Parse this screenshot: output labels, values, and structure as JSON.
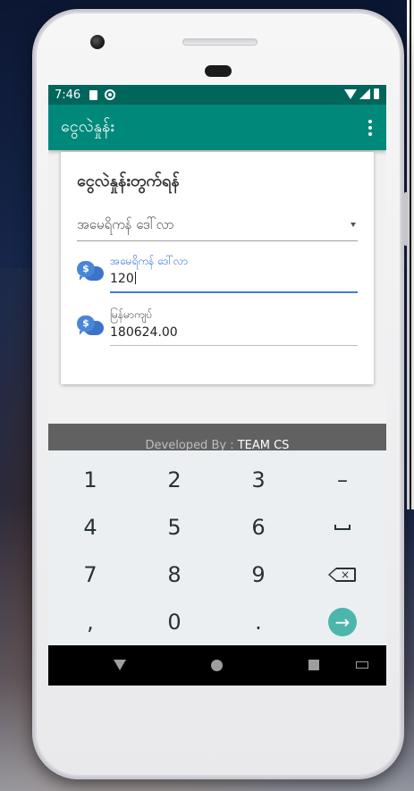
{
  "status_bar": {
    "time": "7:46"
  },
  "app_bar": {
    "title": "ငွေလဲနှုန်း",
    "menu_icon": "kebab-icon"
  },
  "card": {
    "title": "ငွေလဲနှုန်းတွက်ရန်",
    "currency_select": {
      "value": "အမေရိကန် ဒေါ်လာ"
    },
    "amount_field": {
      "label": "အမေရိကန် ဒေါ်လာ",
      "value": "120",
      "icon": "dollar-chat-icon"
    },
    "result_field": {
      "label": "မြန်မာကျပ်",
      "value": "180624.00",
      "icon": "dollar-chat-icon"
    }
  },
  "footer": {
    "prefix": "Developed By : ",
    "team": "TEAM CS"
  },
  "keyboard": {
    "keys": [
      "1",
      "2",
      "3",
      "–",
      "4",
      "5",
      "6",
      "7",
      "8",
      "9",
      ",",
      "0",
      "."
    ],
    "enter_icon": "arrow-right-icon",
    "backspace_icon": "backspace-icon",
    "space_icon": "space-icon"
  },
  "colors": {
    "status_bar": "#00665b",
    "app_bar": "#00897b",
    "accent": "#3b7de0",
    "enter_key": "#4db6ac"
  }
}
